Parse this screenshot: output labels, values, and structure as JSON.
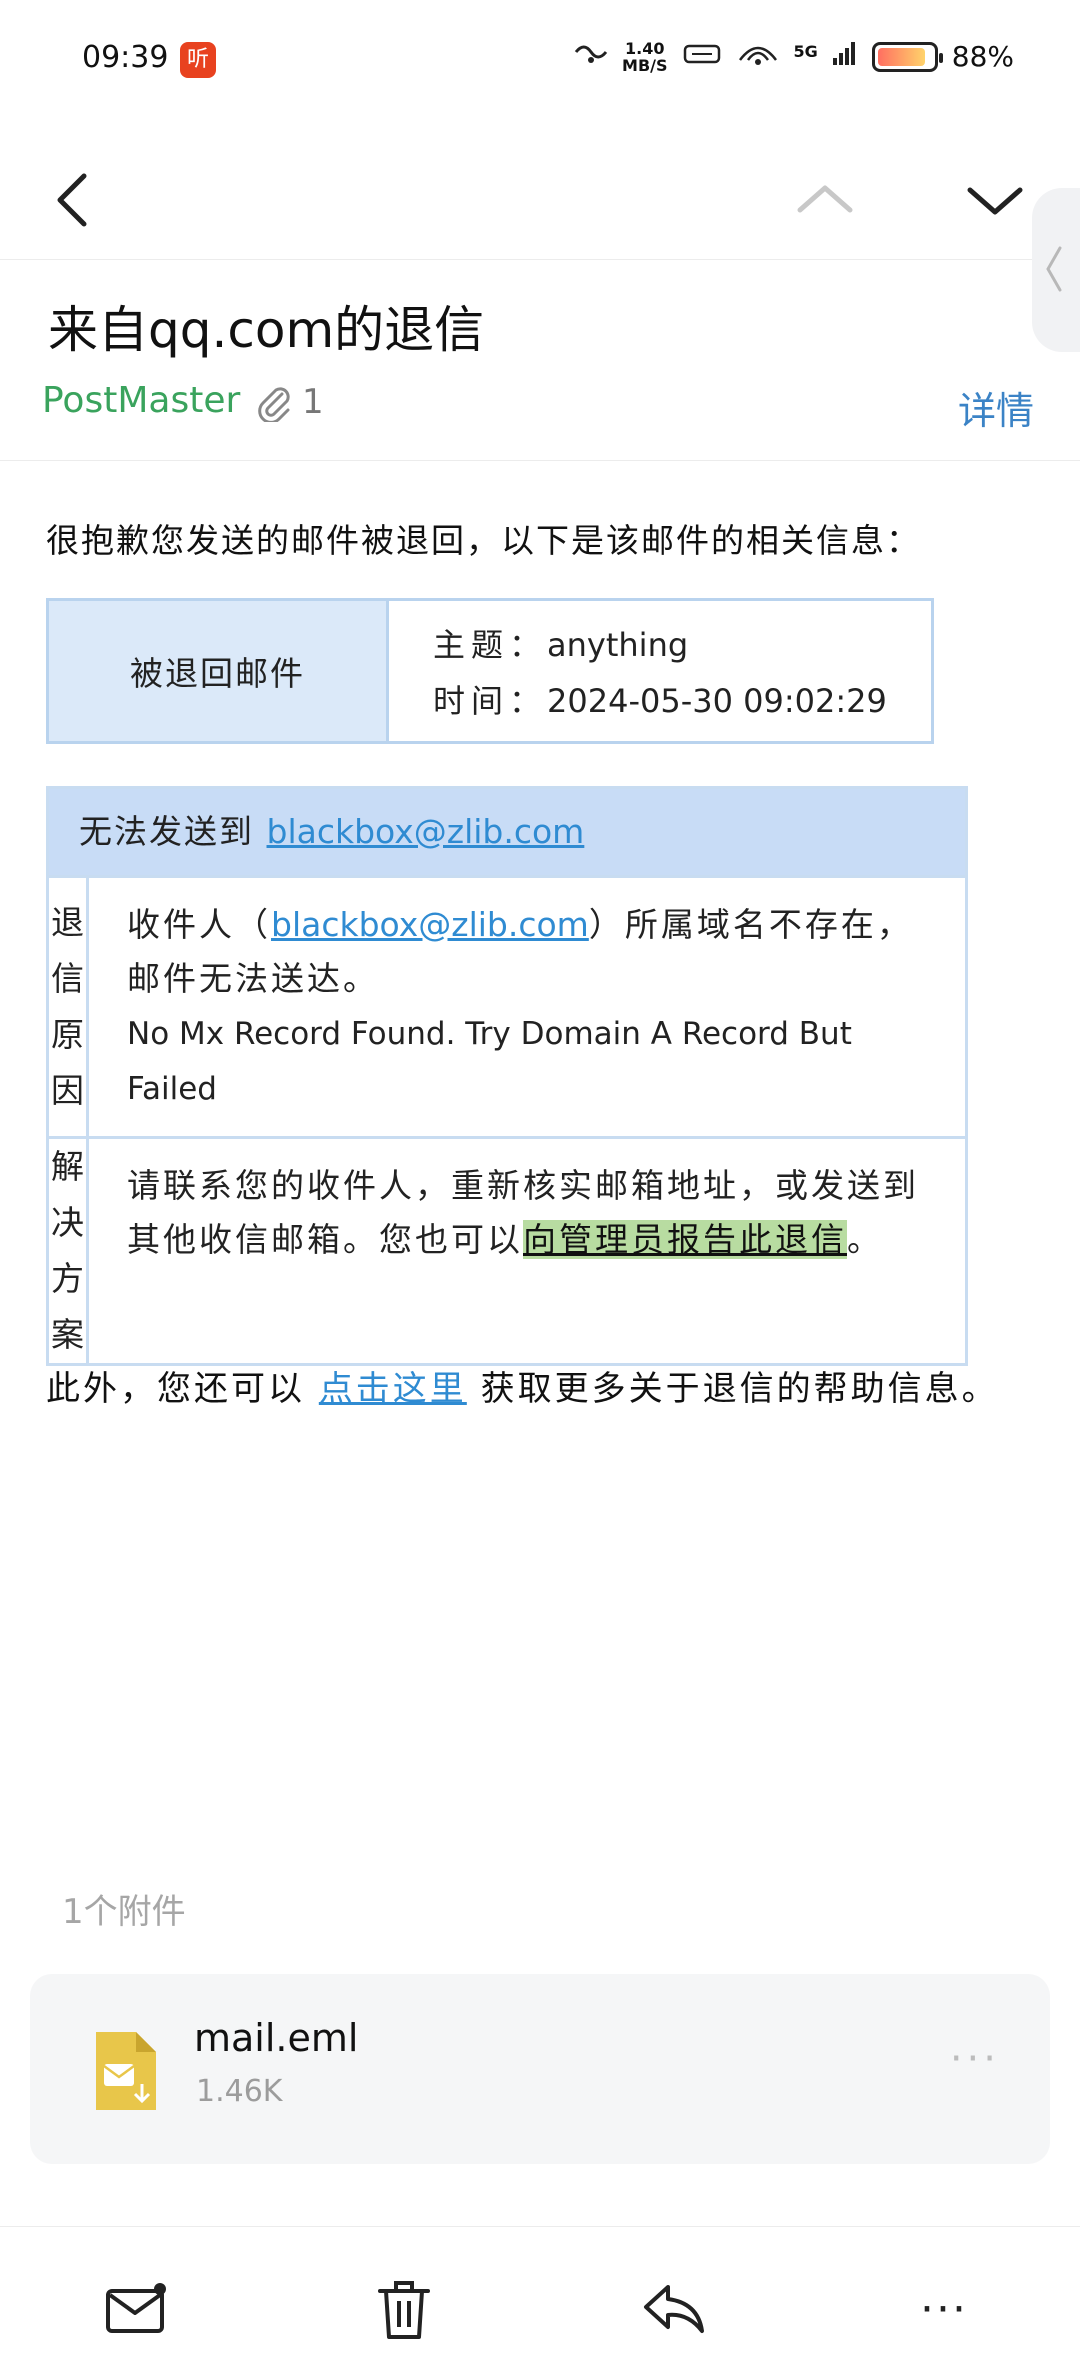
{
  "status_bar": {
    "time": "09:39",
    "app_icon_text": "听",
    "net_speed_value": "1.40",
    "net_speed_unit": "MB/S",
    "network": "5G",
    "battery": "88%",
    "battery_level": 0.88
  },
  "email": {
    "subject": "来自qq.com的退信",
    "sender": "PostMaster",
    "attachment_count": "1",
    "details_label": "详情",
    "intro": "很抱歉您发送的邮件被退回，以下是该邮件的相关信息：",
    "returned": {
      "label": "被退回邮件",
      "subject_key": "主题：",
      "subject_value": "anything",
      "time_key": "时间：",
      "time_value": "2024-05-30 09:02:29"
    },
    "bounce": {
      "head_prefix": "无法发送到 ",
      "address": "blackbox@zlib.com",
      "reason_side": [
        "退",
        "信",
        "原",
        "因"
      ],
      "reason_prefix": "收件人（",
      "reason_suffix": "）所属域名不存在，邮件无法送达。",
      "reason_en": "No Mx Record Found. Try Domain A Record But Failed",
      "solution_side": [
        "解",
        "决",
        "方",
        "案"
      ],
      "solution_text": "请联系您的收件人，重新核实邮箱地址，或发送到其他收信邮箱。您也可以",
      "solution_link": "向管理员报告此退信",
      "solution_end": "。"
    },
    "footer_prefix": "此外，您还可以 ",
    "footer_link": "点击这里",
    "footer_suffix": " 获取更多关于退信的帮助信息。"
  },
  "attachments": {
    "heading": "1个附件",
    "items": [
      {
        "name": "mail.eml",
        "size": "1.46K",
        "icon": "eml-file-icon"
      }
    ],
    "more_label": "···"
  },
  "colors": {
    "sender": "#3aa35d",
    "link": "#2f8bd2",
    "details": "#3b83c6",
    "table_header_bg": "#c8dcf6",
    "highlight": "#b8dca1"
  },
  "toolbar": {
    "icons": [
      "mail-unread-icon",
      "trash-icon",
      "reply-icon",
      "more-icon"
    ],
    "more_label": "···"
  }
}
